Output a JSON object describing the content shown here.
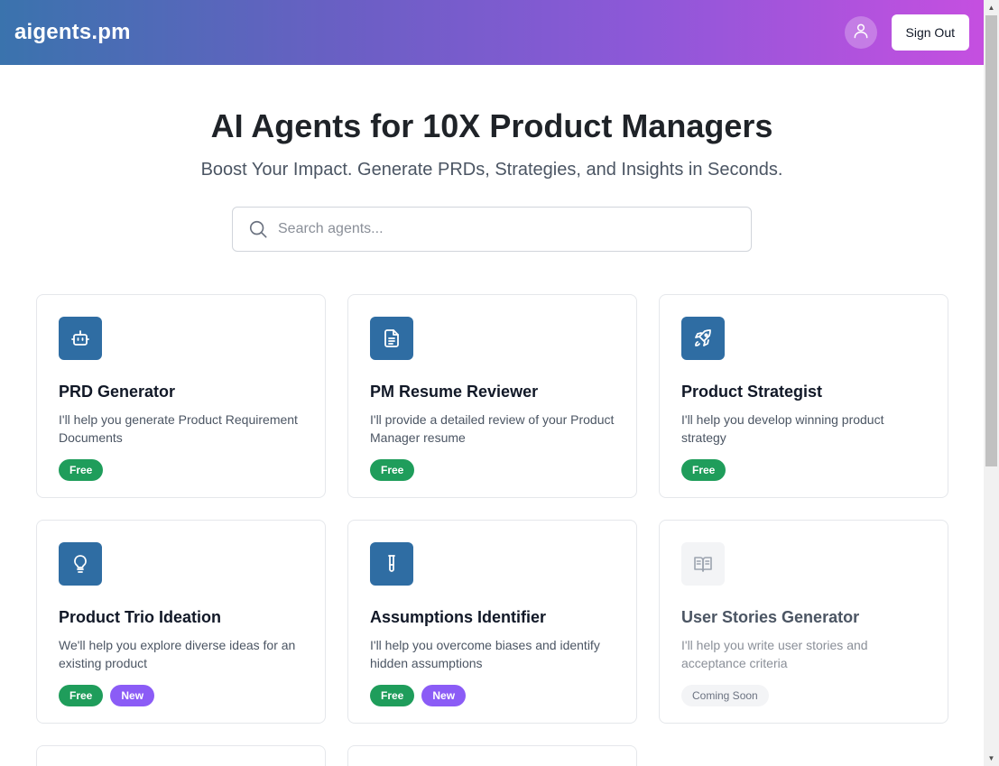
{
  "header": {
    "logo": "aigents.pm",
    "sign_out_label": "Sign Out",
    "avatar_icon": "user-icon",
    "gradient": [
      "#3a73ad",
      "#c54fe0"
    ]
  },
  "hero": {
    "title": "AI Agents for 10X Product Managers",
    "subtitle": "Boost Your Impact. Generate PRDs, Strategies, and Insights in Seconds."
  },
  "search": {
    "placeholder": "Search agents...",
    "value": ""
  },
  "colors": {
    "icon_bg": "#2f6da3",
    "free_badge": "#1f9d5b",
    "new_badge": "#8b5cf6"
  },
  "agents": [
    {
      "title": "PRD Generator",
      "description": "I'll help you generate Product Requirement Documents",
      "icon": "robot-icon",
      "badges": [
        "Free"
      ]
    },
    {
      "title": "PM Resume Reviewer",
      "description": "I'll provide a detailed review of your Product Manager resume",
      "icon": "document-icon",
      "badges": [
        "Free"
      ]
    },
    {
      "title": "Product Strategist",
      "description": "I'll help you develop winning product strategy",
      "icon": "rocket-icon",
      "badges": [
        "Free"
      ]
    },
    {
      "title": "Product Trio Ideation",
      "description": "We'll help you explore diverse ideas for an existing product",
      "icon": "lightbulb-icon",
      "badges": [
        "Free",
        "New"
      ]
    },
    {
      "title": "Assumptions Identifier",
      "description": "I'll help you overcome biases and identify hidden assumptions",
      "icon": "test-tube-icon",
      "badges": [
        "Free",
        "New"
      ]
    },
    {
      "title": "User Stories Generator",
      "description": "I'll help you write user stories and acceptance criteria",
      "icon": "book-icon",
      "badges": [
        "Coming Soon"
      ]
    }
  ]
}
